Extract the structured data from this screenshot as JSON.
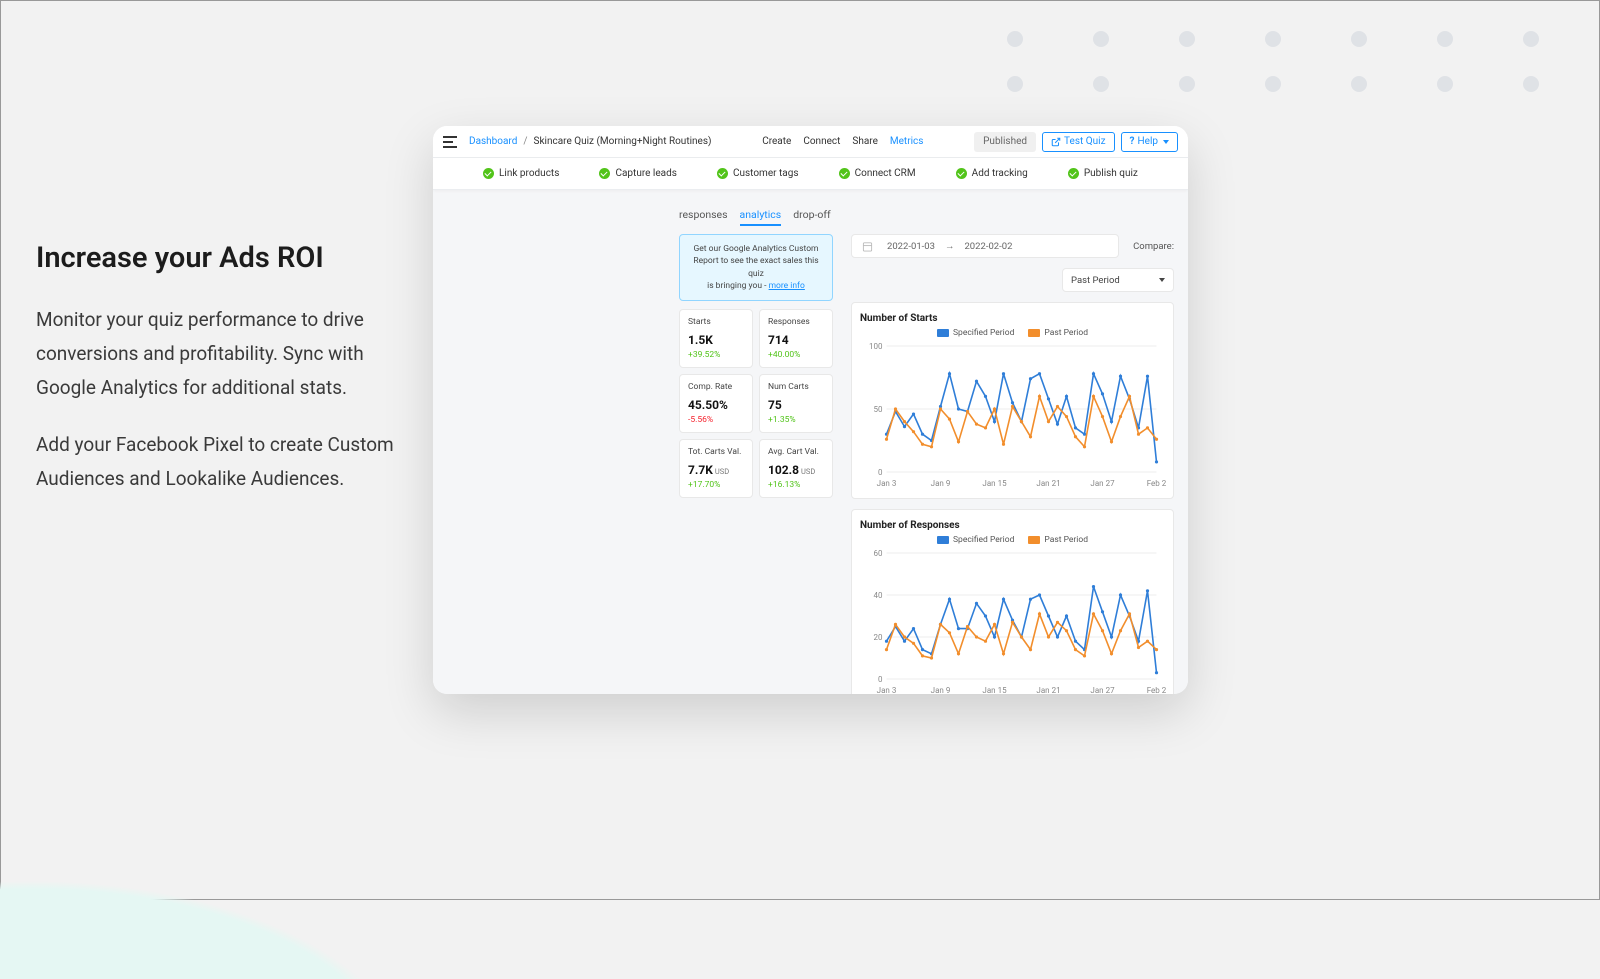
{
  "marketing": {
    "heading": "Increase your Ads ROI",
    "para1": "Monitor your quiz performance to drive conversions and profitability. Sync with Google Analytics for additional stats.",
    "para2": "Add your Facebook Pixel to create Custom Audiences and Lookalike Audiences."
  },
  "breadcrumb": {
    "dashboard": "Dashboard",
    "current": "Skincare Quiz (Morning+Night Routines)"
  },
  "nav": {
    "create": "Create",
    "connect": "Connect",
    "share": "Share",
    "metrics": "Metrics"
  },
  "topbar": {
    "published": "Published",
    "test_quiz": "Test Quiz",
    "help": "Help"
  },
  "steps": [
    "Link products",
    "Capture leads",
    "Customer tags",
    "Connect CRM",
    "Add tracking",
    "Publish quiz"
  ],
  "subtabs": {
    "responses": "responses",
    "analytics": "analytics",
    "dropoff": "drop-off"
  },
  "ga_box": {
    "line1": "Get our Google Analytics Custom",
    "line2": "Report to see the exact sales this quiz",
    "line3": "is bringing you - ",
    "link": "more info"
  },
  "metrics": [
    {
      "label": "Starts",
      "value": "1.5K",
      "unit": "",
      "delta": "+39.52%",
      "dir": "pos"
    },
    {
      "label": "Responses",
      "value": "714",
      "unit": "",
      "delta": "+40.00%",
      "dir": "pos"
    },
    {
      "label": "Comp. Rate",
      "value": "45.50%",
      "unit": "",
      "delta": "-5.56%",
      "dir": "neg"
    },
    {
      "label": "Num Carts",
      "value": "75",
      "unit": "",
      "delta": "+1.35%",
      "dir": "pos"
    },
    {
      "label": "Tot. Carts Val.",
      "value": "7.7K",
      "unit": "USD",
      "delta": "+17.70%",
      "dir": "pos"
    },
    {
      "label": "Avg. Cart Val.",
      "value": "102.8",
      "unit": "USD",
      "delta": "+16.13%",
      "dir": "pos"
    }
  ],
  "filters": {
    "date_from": "2022-01-03",
    "date_to": "2022-02-02",
    "compare_label": "Compare:",
    "compare_value": "Past Period"
  },
  "legend": {
    "specified": "Specified Period",
    "past": "Past Period"
  },
  "chart1_title": "Number of Starts",
  "chart2_title": "Number of Responses",
  "chart_data": [
    {
      "type": "line",
      "title": "Number of Starts",
      "xlabel": "",
      "ylabel": "",
      "ylim": [
        0,
        100
      ],
      "x_ticks": [
        "Jan 3",
        "Jan 9",
        "Jan 15",
        "Jan 21",
        "Jan 27",
        "Feb 2"
      ],
      "y_ticks": [
        0,
        50,
        100
      ],
      "series": [
        {
          "name": "Specified Period",
          "values": [
            30,
            48,
            36,
            46,
            30,
            25,
            52,
            78,
            50,
            48,
            72,
            60,
            40,
            78,
            55,
            40,
            74,
            78,
            58,
            38,
            60,
            35,
            30,
            78,
            62,
            40,
            76,
            58,
            35,
            76,
            8
          ]
        },
        {
          "name": "Past Period",
          "values": [
            26,
            50,
            40,
            32,
            22,
            20,
            50,
            42,
            24,
            48,
            38,
            35,
            50,
            22,
            52,
            40,
            28,
            60,
            40,
            52,
            44,
            28,
            20,
            60,
            44,
            24,
            44,
            60,
            30,
            35,
            26
          ]
        }
      ]
    },
    {
      "type": "line",
      "title": "Number of Responses",
      "xlabel": "",
      "ylabel": "",
      "ylim": [
        0,
        60
      ],
      "x_ticks": [
        "Jan 3",
        "Jan 9",
        "Jan 15",
        "Jan 21",
        "Jan 27",
        "Feb 2"
      ],
      "y_ticks": [
        0,
        20,
        40,
        60
      ],
      "series": [
        {
          "name": "Specified Period",
          "values": [
            18,
            25,
            18,
            24,
            14,
            12,
            26,
            38,
            24,
            24,
            36,
            30,
            20,
            38,
            28,
            20,
            38,
            40,
            30,
            20,
            30,
            18,
            14,
            44,
            32,
            20,
            40,
            30,
            18,
            42,
            3
          ]
        },
        {
          "name": "Past Period",
          "values": [
            14,
            26,
            20,
            17,
            11,
            10,
            26,
            22,
            12,
            25,
            20,
            18,
            26,
            12,
            27,
            20,
            14,
            31,
            20,
            27,
            23,
            14,
            11,
            31,
            23,
            12,
            23,
            31,
            15,
            18,
            14
          ]
        }
      ]
    }
  ]
}
